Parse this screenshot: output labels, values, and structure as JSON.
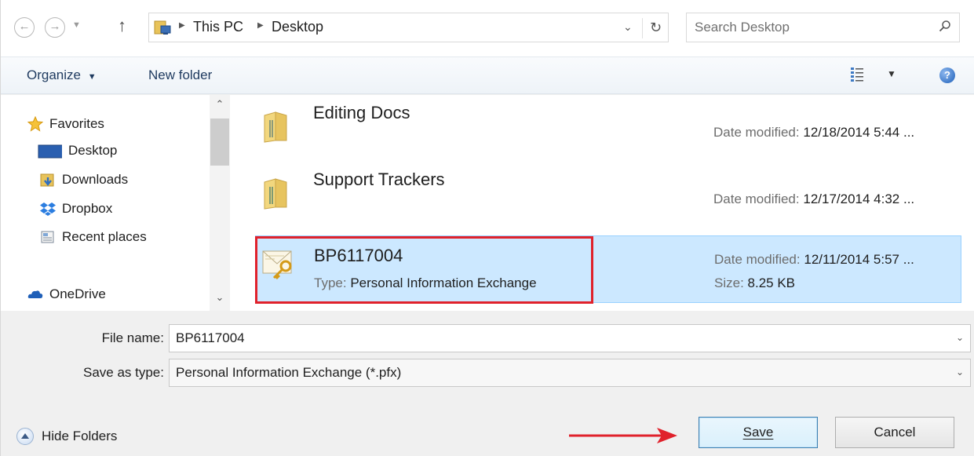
{
  "address_bar": {
    "crumbs": [
      "This PC",
      "Desktop"
    ],
    "search_placeholder": "Search Desktop"
  },
  "toolbar": {
    "organize_label": "Organize",
    "new_folder_label": "New folder",
    "help_label": "?"
  },
  "nav_pane": {
    "items": [
      {
        "label": "Favorites",
        "icon": "star-icon"
      },
      {
        "label": "Desktop",
        "icon": "desktop-icon"
      },
      {
        "label": "Downloads",
        "icon": "downloads-icon"
      },
      {
        "label": "Dropbox",
        "icon": "dropbox-icon"
      },
      {
        "label": "Recent places",
        "icon": "recent-places-icon"
      },
      {
        "label": "OneDrive",
        "icon": "onedrive-icon"
      }
    ]
  },
  "files": [
    {
      "name": "Editing Docs",
      "date_label": "Date modified:",
      "date": "12/18/2014 5:44 ...",
      "icon": "folder-icon"
    },
    {
      "name": "Support Trackers",
      "date_label": "Date modified:",
      "date": "12/17/2014 4:32 ...",
      "icon": "folder-icon"
    },
    {
      "name": "BP6117004",
      "type_label": "Type:",
      "type": "Personal Information Exchange",
      "date_label": "Date modified:",
      "date": "12/11/2014 5:57 ...",
      "size_label": "Size:",
      "size": "8.25 KB",
      "icon": "certificate-icon",
      "selected": true
    }
  ],
  "form": {
    "file_name_label": "File name:",
    "file_name_value": "BP6117004",
    "save_type_label": "Save as type:",
    "save_type_value": "Personal Information Exchange (*.pfx)",
    "hide_folders_label": "Hide Folders",
    "save_label": "Save",
    "cancel_label": "Cancel"
  },
  "colors": {
    "selection": "#cce8ff",
    "annotation_red": "#e0212b"
  }
}
